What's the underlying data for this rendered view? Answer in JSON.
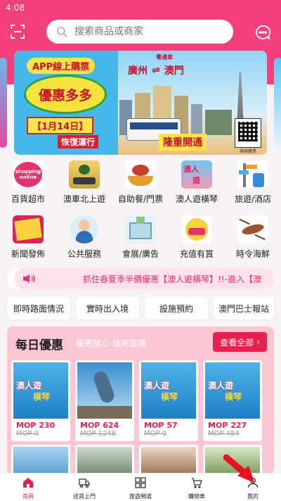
{
  "status_bar": {
    "time": "4:08"
  },
  "header": {
    "search_placeholder": "搜索商品或商家"
  },
  "banner": {
    "line1": "APP線上購票",
    "line2": "優惠多多",
    "date": "【1月14日】",
    "resume": "恢復運行",
    "route_from": "廣州",
    "route_to": "澳門",
    "route_sub": "粵通車",
    "grand_open": "隆重開通",
    "qr_caption": "掃碼購票"
  },
  "categories": [
    {
      "label": "百貨超市",
      "icon": "shopping-online-icon",
      "badge": "shopping online"
    },
    {
      "label": "澳車北上遊",
      "icon": "car-north-icon"
    },
    {
      "label": "自助餐/門票",
      "icon": "buffet-icon"
    },
    {
      "label": "澳人遊橫琴",
      "icon": "hengqin-icon"
    },
    {
      "label": "旅遊/酒店",
      "icon": "travel-icon"
    },
    {
      "label": "新聞發佈",
      "icon": "news-icon"
    },
    {
      "label": "公共服務",
      "icon": "public-service-icon"
    },
    {
      "label": "會展/廣告",
      "icon": "exhibition-icon"
    },
    {
      "label": "充值有賞",
      "icon": "topup-icon"
    },
    {
      "label": "時令海鮮",
      "icon": "seafood-icon"
    }
  ],
  "marquee": {
    "text": "抓住春夏季半價優惠【澳人遊橫琴】!!-進入【澳"
  },
  "quick_links": [
    "即時路面情況",
    "實時出入境",
    "設施預約",
    "澳門巴士報站"
  ],
  "deals": {
    "title": "每日優惠",
    "subtitle": "優惠放心 快來搶購",
    "view_all": "查看全部",
    "items": [
      {
        "price": "MOP 230",
        "original": "MOP 0",
        "img": "hengqin"
      },
      {
        "price": "MOP 624",
        "original": "MOP 1248",
        "img": "aquarium"
      },
      {
        "price": "MOP 57",
        "original": "MOP 0",
        "img": "hengqin"
      },
      {
        "price": "MOP 227",
        "original": "MOP 454",
        "img": "hengqin"
      }
    ]
  },
  "tabbar": [
    {
      "label": "首頁",
      "icon": "home-icon",
      "active": true
    },
    {
      "label": "送貨上門",
      "icon": "delivery-icon",
      "active": false
    },
    {
      "label": "旅遊頻道",
      "icon": "grid-icon",
      "active": false
    },
    {
      "label": "購物車",
      "icon": "cart-icon",
      "active": false
    },
    {
      "label": "我的",
      "icon": "user-icon",
      "active": false
    }
  ],
  "colors": {
    "brand": "#f43f7a",
    "accent": "#e8204f"
  }
}
